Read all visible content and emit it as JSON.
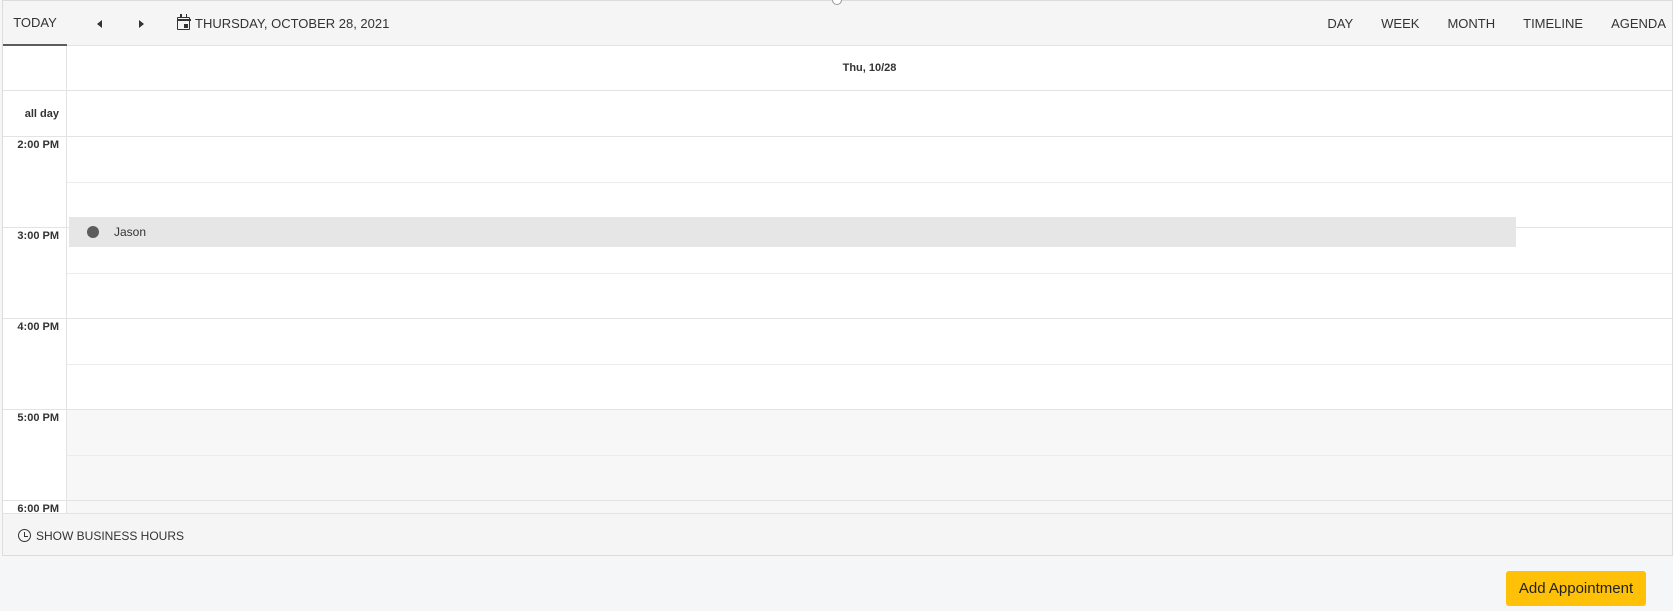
{
  "toolbar": {
    "today_label": "Today",
    "current_date": "Thursday, October 28, 2021",
    "views": [
      "Day",
      "Week",
      "Month",
      "Timeline",
      "Agenda"
    ]
  },
  "header": {
    "date": "Thu, 10/28",
    "allday_label": "all day"
  },
  "hours": [
    "2:00 PM",
    "3:00 PM",
    "4:00 PM",
    "5:00 PM",
    "6:00 PM"
  ],
  "appointments": [
    {
      "title": "Jason",
      "color": "#5c5c5c",
      "background": "#e6e6e6"
    }
  ],
  "footer": {
    "business_hours_label": "Show business hours"
  },
  "actions": {
    "add_label": "Add Appointment",
    "add_color": "#ffc107"
  }
}
